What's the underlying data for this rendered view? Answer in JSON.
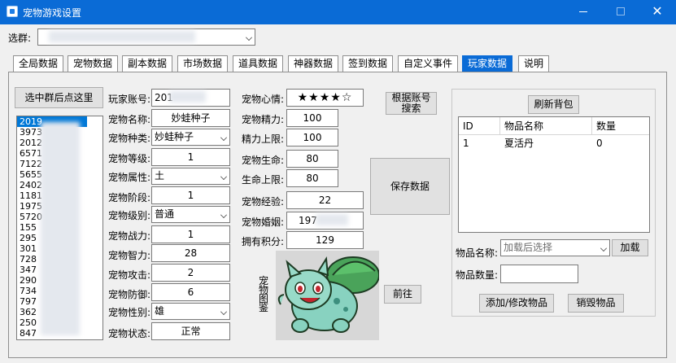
{
  "window": {
    "title": "宠物游戏设置",
    "controls": {
      "minimize": "─",
      "maximize": "☐",
      "close": "✕"
    }
  },
  "group_select": {
    "label": "选群:",
    "value": ""
  },
  "tabs": [
    "全局数据",
    "宠物数据",
    "副本数据",
    "市场数据",
    "道具数据",
    "神器数据",
    "签到数据",
    "自定义事件",
    "玩家数据",
    "说明"
  ],
  "active_tab": "玩家数据",
  "left": {
    "select_group_button": "选中群后点这里",
    "list_items": [
      "2019",
      "3973",
      "2012",
      "6571",
      "7122",
      "5655",
      "2402",
      "1181",
      "1975",
      "5720",
      "155",
      "295",
      "301",
      "728",
      "347",
      "290",
      "734",
      "797",
      "362",
      "250",
      "847"
    ]
  },
  "player": {
    "account_label": "玩家账号:",
    "account_value": "201",
    "pet_name_label": "宠物名称:",
    "pet_name_value": "妙蛙种子",
    "pet_species_label": "宠物种类:",
    "pet_species_value": "妙蛙种子",
    "pet_level_label": "宠物等级:",
    "pet_level_value": "1",
    "pet_attr_label": "宠物属性:",
    "pet_attr_value": "土",
    "pet_stage_label": "宠物阶段:",
    "pet_stage_value": "1",
    "pet_grade_label": "宠物级别:",
    "pet_grade_value": "普通",
    "pet_power_label": "宠物战力:",
    "pet_power_value": "1",
    "pet_int_label": "宠物智力:",
    "pet_int_value": "28",
    "pet_atk_label": "宠物攻击:",
    "pet_atk_value": "2",
    "pet_def_label": "宠物防御:",
    "pet_def_value": "6",
    "pet_gender_label": "宠物性别:",
    "pet_gender_value": "雄",
    "pet_status_label": "宠物状态:",
    "pet_status_value": "正常"
  },
  "stats": {
    "mood_label": "宠物心情:",
    "mood_value": "★★★★☆",
    "energy_label": "宠物精力:",
    "energy_value": "100",
    "energy_max_label": "精力上限:",
    "energy_max_value": "100",
    "hp_label": "宠物生命:",
    "hp_value": "80",
    "hp_max_label": "生命上限:",
    "hp_max_value": "80",
    "exp_label": "宠物经验:",
    "exp_value": "22",
    "marriage_label": "宠物婚姻:",
    "marriage_value": "197",
    "points_label": "拥有积分:",
    "points_value": "129"
  },
  "buttons": {
    "search_by_account": "根据账号搜索",
    "save": "保存数据",
    "goto": "前往",
    "refresh_bag": "刷新背包",
    "load": "加载",
    "add_modify": "添加/修改物品",
    "destroy": "销毁物品"
  },
  "pet_image_label": "宠物图鉴",
  "bag": {
    "columns": [
      "ID",
      "物品名称",
      "数量"
    ],
    "rows": [
      {
        "id": "1",
        "name": "夏活丹",
        "qty": "0"
      }
    ]
  },
  "item_form": {
    "name_label": "物品名称:",
    "name_placeholder": "加载后选择",
    "qty_label": "物品数量:",
    "qty_value": ""
  },
  "colors": {
    "accent": "#0a6bd6",
    "selection": "#0078d7"
  },
  "icons": [
    "app-icon",
    "pet-image"
  ]
}
